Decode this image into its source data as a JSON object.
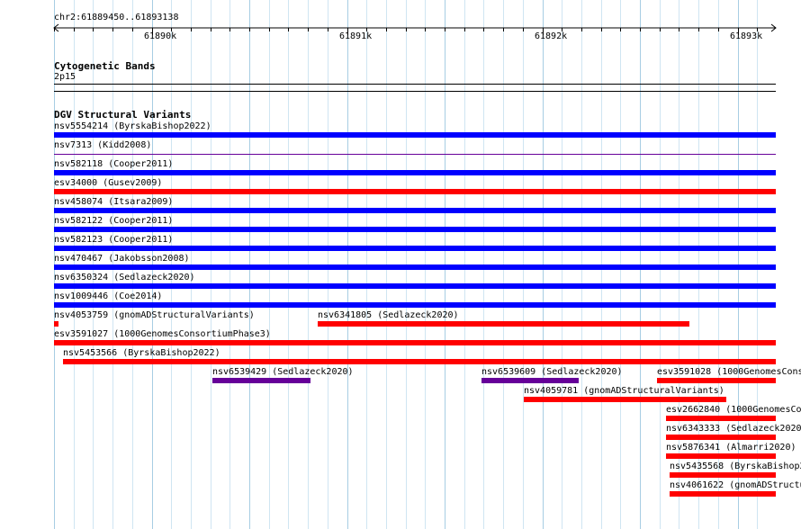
{
  "ruler": {
    "locus": "chr2:61889450..61893138",
    "tick_labels": [
      "61890k",
      "61891k",
      "61892k",
      "61893k"
    ]
  },
  "tracks": {
    "cytoband": {
      "title": "Cytogenetic Bands",
      "band": "2p15"
    },
    "dgv": {
      "title": "DGV Structural Variants",
      "colors": {
        "loss": "#ff0000",
        "gain": "#0000ff",
        "mixed": "#660099"
      },
      "features": [
        {
          "label": "nsv5554214 (ByrskaBishop2022)",
          "type": "gain"
        },
        {
          "label": "nsv7313 (Kidd2008)",
          "type": "mixed"
        },
        {
          "label": "nsv582118 (Cooper2011)",
          "type": "gain"
        },
        {
          "label": "esv34000 (Gusev2009)",
          "type": "loss"
        },
        {
          "label": "nsv458074 (Itsara2009)",
          "type": "gain"
        },
        {
          "label": "nsv582122 (Cooper2011)",
          "type": "gain"
        },
        {
          "label": "nsv582123 (Cooper2011)",
          "type": "gain"
        },
        {
          "label": "nsv470467 (Jakobsson2008)",
          "type": "gain"
        },
        {
          "label": "nsv6350324 (Sedlazeck2020)",
          "type": "gain"
        },
        {
          "label": "nsv1009446 (Coe2014)",
          "type": "gain"
        },
        {
          "label": "nsv4053759 (gnomADStructuralVariants)",
          "type": "loss"
        },
        {
          "label": "nsv6341805 (Sedlazeck2020)",
          "type": "loss"
        },
        {
          "label": "esv3591027 (1000GenomesConsortiumPhase3)",
          "type": "loss"
        },
        {
          "label": "nsv5453566 (ByrskaBishop2022)",
          "type": "loss"
        },
        {
          "label": "nsv6539429 (Sedlazeck2020)",
          "type": "mixed"
        },
        {
          "label": "nsv6539609 (Sedlazeck2020)",
          "type": "mixed"
        },
        {
          "label": "esv3591028 (1000GenomesCons",
          "type": "loss"
        },
        {
          "label": "nsv4059781 (gnomADStructuralVariants)",
          "type": "loss"
        },
        {
          "label": "esv2662840 (1000GenomesCo",
          "type": "loss"
        },
        {
          "label": "nsv6343333 (Sedlazeck2020",
          "type": "loss"
        },
        {
          "label": "nsv5876341 (Almarri2020)",
          "type": "loss"
        },
        {
          "label": "nsv5435568 (ByrskaBishop2",
          "type": "loss"
        },
        {
          "label": "nsv4061622 (gnomADStructu",
          "type": "loss"
        }
      ]
    }
  }
}
